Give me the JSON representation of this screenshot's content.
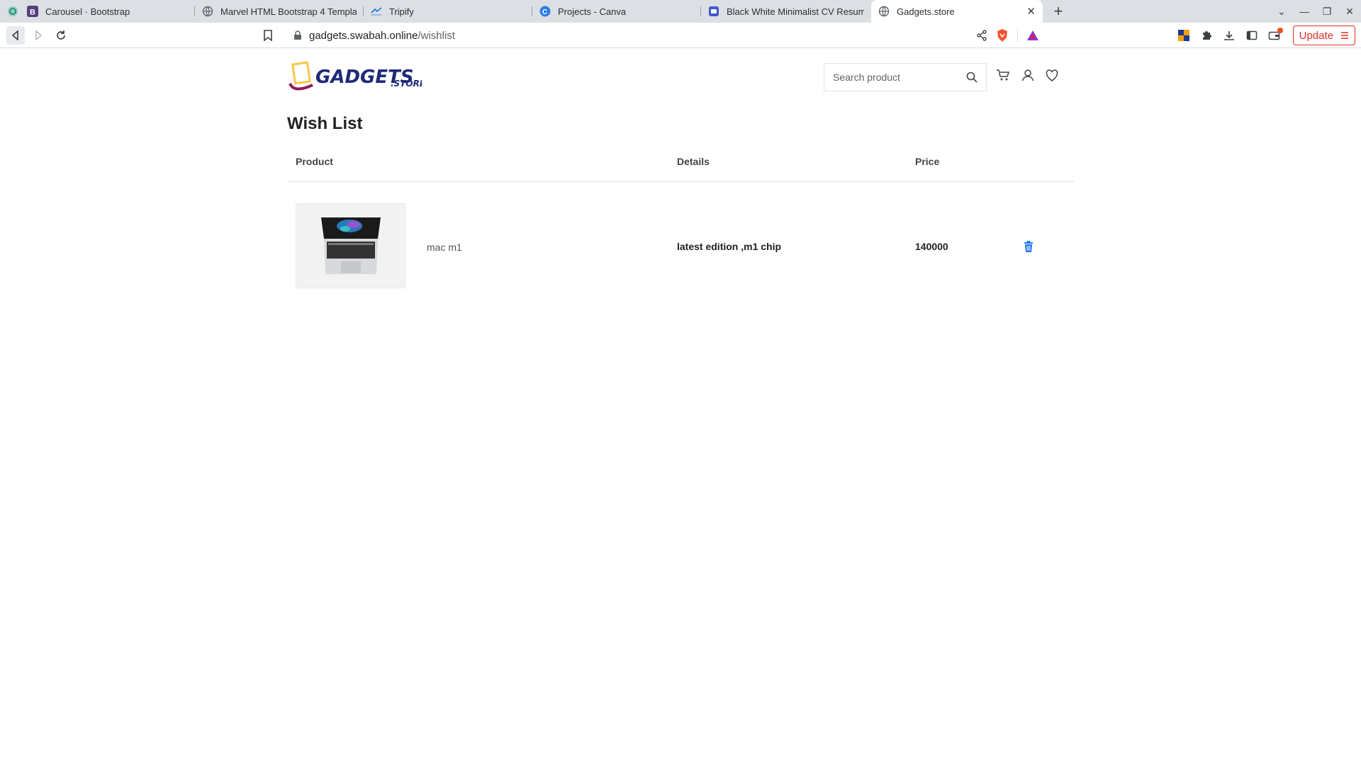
{
  "browser": {
    "tabs": [
      {
        "title": "Carousel · Bootstrap",
        "icon": "bootstrap-icon"
      },
      {
        "title": "Marvel HTML Bootstrap 4 Template",
        "icon": "globe-icon"
      },
      {
        "title": "Tripify",
        "icon": "tripify-icon"
      },
      {
        "title": "Projects - Canva",
        "icon": "canva-icon"
      },
      {
        "title": "Black White Minimalist CV Resume",
        "icon": "canva-doc-icon"
      },
      {
        "title": "Gadgets.store",
        "icon": "globe-icon"
      }
    ],
    "active_tab": 5,
    "url_host": "gadgets.swabah.online",
    "url_path": "/wishlist",
    "update_label": "Update",
    "accent_color": "#d93025"
  },
  "site": {
    "logo_text": "GADGETS",
    "logo_suffix": ".STORE",
    "search_placeholder": "Search product"
  },
  "wishlist": {
    "title": "Wish List",
    "columns": {
      "product": "Product",
      "details": "Details",
      "price": "Price"
    },
    "items": [
      {
        "name": "mac m1",
        "details": "latest edition ,m1 chip",
        "price": "140000"
      }
    ],
    "delete_color": "#1a73e8"
  }
}
